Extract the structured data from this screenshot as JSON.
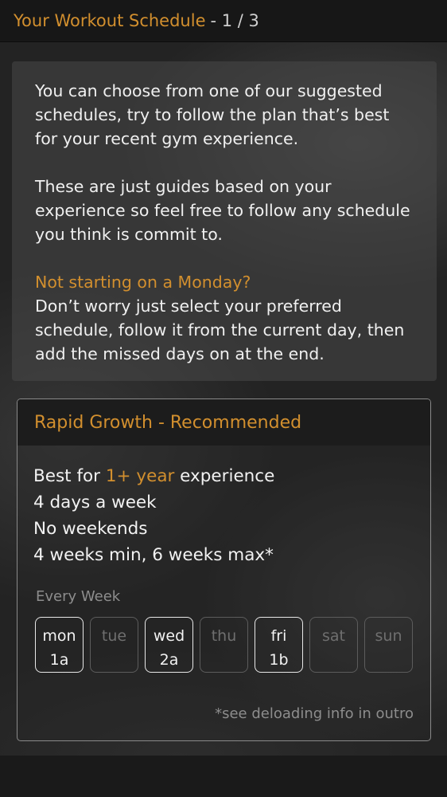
{
  "header": {
    "title": "Your Workout Schedule",
    "step": "- 1 / 3"
  },
  "intro": {
    "para1": "You can choose from one of our suggested schedules, try to follow the plan that’s best for your recent gym experience.",
    "para2": "These are just guides based on your experience so feel free to follow any schedule you think is commit to.",
    "question": "Not starting on a Monday?",
    "para3": "Don’t worry just select your preferred schedule, follow it from the current day, then add the missed days on at the end."
  },
  "plan": {
    "title": "Rapid Growth - Recommended",
    "experience_prefix": "Best for ",
    "experience_value": "1+ year",
    "experience_suffix": " experience",
    "days_per_week": "4 days a week",
    "weekends": "No weekends",
    "duration": "4 weeks min, 6 weeks max*",
    "frequency_label": "Every Week",
    "days": [
      {
        "name": "mon",
        "code": "1a",
        "active": true
      },
      {
        "name": "tue",
        "code": "",
        "active": false
      },
      {
        "name": "wed",
        "code": "2a",
        "active": true
      },
      {
        "name": "thu",
        "code": "",
        "active": false
      },
      {
        "name": "fri",
        "code": "1b",
        "active": true
      },
      {
        "name": "sat",
        "code": "",
        "active": false
      },
      {
        "name": "sun",
        "code": "",
        "active": false
      }
    ],
    "footnote": "*see deloading info in outro"
  },
  "colors": {
    "accent": "#d28f2e",
    "background": "#232323",
    "header_bg": "#171717"
  }
}
